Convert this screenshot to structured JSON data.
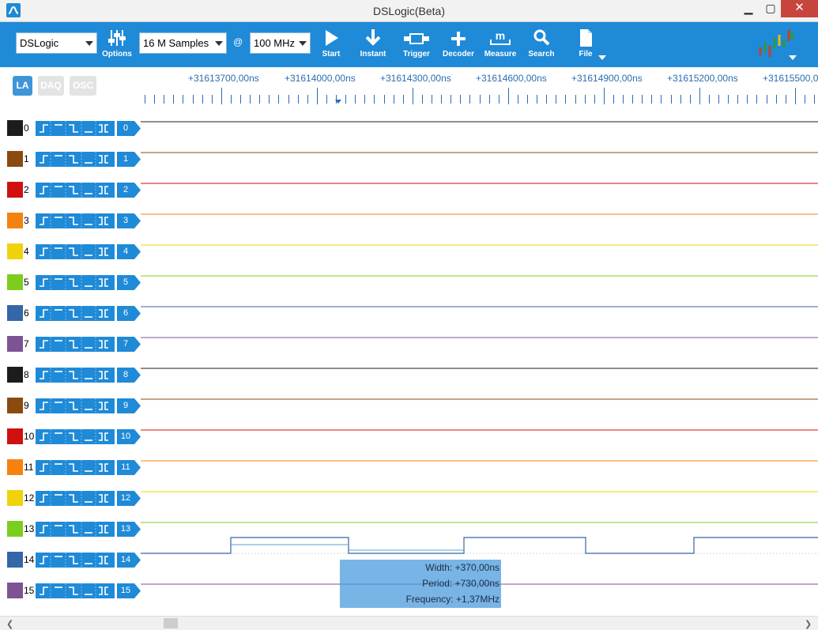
{
  "window": {
    "title": "DSLogic(Beta)",
    "min_glyph": "▁",
    "max_glyph": "▢",
    "close_glyph": "✕"
  },
  "toolbar": {
    "device": "DSLogic",
    "samples": "16 M Samples",
    "at": "@",
    "rate": "100 MHz",
    "options_label": "Options",
    "start_label": "Start",
    "instant_label": "Instant",
    "trigger_label": "Trigger",
    "decoder_label": "Decoder",
    "measure_label": "Measure",
    "search_label": "Search",
    "file_label": "File"
  },
  "modes": {
    "la": "LA",
    "daq": "DAQ",
    "osc": "OSC",
    "active": "LA"
  },
  "ruler": {
    "labels": [
      "+31613700,00ns",
      "+31614000,00ns",
      "+31614300,00ns",
      "+31614600,00ns",
      "+31614900,00ns",
      "+31615200,00ns",
      "+31615500,00ns"
    ]
  },
  "channels": [
    {
      "id": "0",
      "color": "#1c1c1c"
    },
    {
      "id": "1",
      "color": "#8b4a0f"
    },
    {
      "id": "2",
      "color": "#d01010"
    },
    {
      "id": "3",
      "color": "#f5820f"
    },
    {
      "id": "4",
      "color": "#f0d20a"
    },
    {
      "id": "5",
      "color": "#7cce1e"
    },
    {
      "id": "6",
      "color": "#3466a8"
    },
    {
      "id": "7",
      "color": "#7c5494"
    },
    {
      "id": "8",
      "color": "#1c1c1c"
    },
    {
      "id": "9",
      "color": "#8b4a0f"
    },
    {
      "id": "10",
      "color": "#d01010"
    },
    {
      "id": "11",
      "color": "#f5820f"
    },
    {
      "id": "12",
      "color": "#f0d20a"
    },
    {
      "id": "13",
      "color": "#7cce1e"
    },
    {
      "id": "14",
      "color": "#3466a8"
    },
    {
      "id": "15",
      "color": "#7c5494"
    }
  ],
  "measurement": {
    "width": "Width: +370,00ns",
    "period": "Period: +730,00ns",
    "frequency": "Frequency: +1,37MHz"
  },
  "colors": {
    "accent": "#1f8ad7",
    "ruler_text": "#2a6db0",
    "close": "#c7453d"
  }
}
